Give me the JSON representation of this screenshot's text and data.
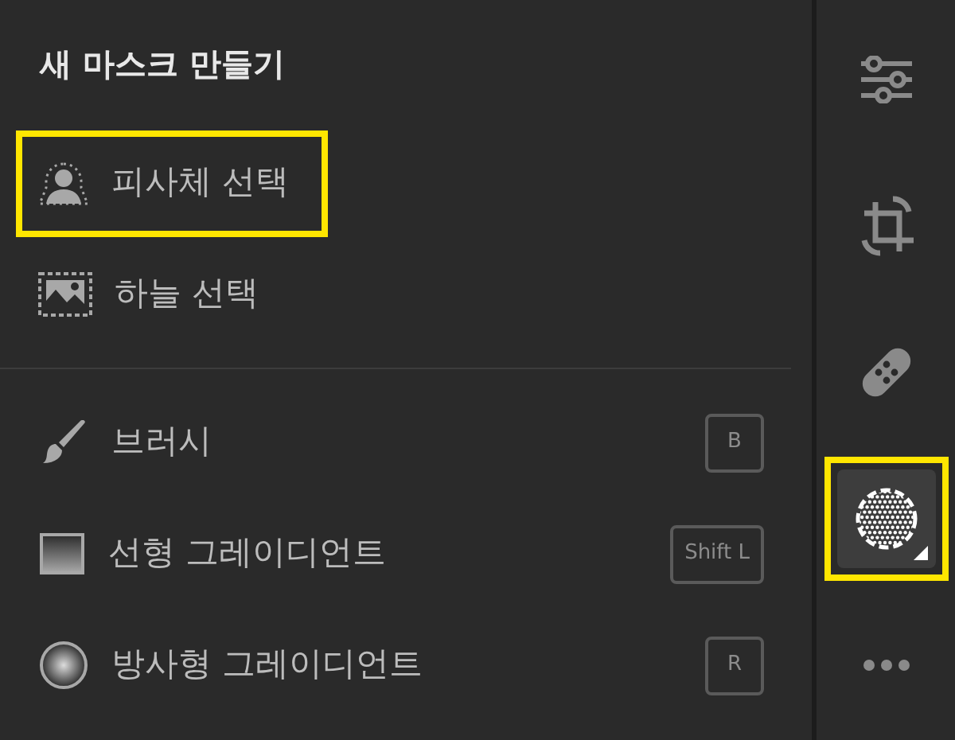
{
  "panel": {
    "title": "새 마스크 만들기",
    "selections": [
      {
        "kind": "subject",
        "label": "피사체 선택",
        "highlighted": true
      },
      {
        "kind": "sky",
        "label": "하늘 선택",
        "highlighted": false
      }
    ],
    "tools": [
      {
        "kind": "brush",
        "label": "브러시",
        "shortcut": "B"
      },
      {
        "kind": "linear",
        "label": "선형 그레이디언트",
        "shortcut": "Shift L"
      },
      {
        "kind": "radial",
        "label": "방사형 그레이디언트",
        "shortcut": "R"
      }
    ]
  },
  "toolbar": [
    {
      "kind": "sliders",
      "selected": false,
      "highlighted": false
    },
    {
      "kind": "crop",
      "selected": false,
      "highlighted": false
    },
    {
      "kind": "heal",
      "selected": false,
      "highlighted": false
    },
    {
      "kind": "mask",
      "selected": true,
      "highlighted": true
    },
    {
      "kind": "more",
      "selected": false,
      "highlighted": false
    }
  ]
}
